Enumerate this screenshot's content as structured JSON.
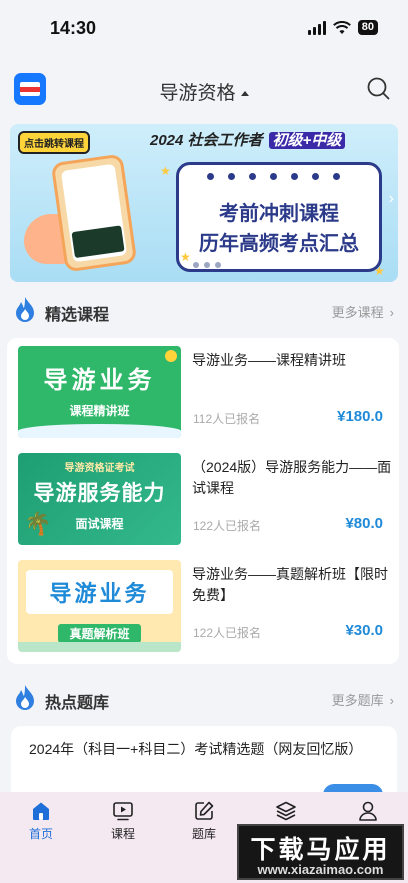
{
  "status_bar": {
    "time": "14:30",
    "battery": "80"
  },
  "header": {
    "title": "导游资格",
    "logo_icon": "book-logo-icon",
    "search_icon": "search-icon"
  },
  "banner": {
    "tag": "点击跳转课程",
    "headline": "2024 社会工作者",
    "highlight": "初级+中级",
    "line1": "考前冲刺课程",
    "line2": "历年高频考点汇总"
  },
  "featured": {
    "title": "精选课程",
    "more": "更多课程",
    "courses": [
      {
        "name": "导游业务——课程精讲班",
        "enrolled": "112人已报名",
        "price": "¥180.0",
        "thumb_title": "导游业务",
        "thumb_sub": "课程精讲班"
      },
      {
        "name": "（2024版）导游服务能力——面试课程",
        "enrolled": "122人已报名",
        "price": "¥80.0",
        "thumb_top": "导游资格证考试",
        "thumb_title": "导游服务能力",
        "thumb_sub": "面试课程"
      },
      {
        "name": "导游业务——真题解析班【限时免费】",
        "enrolled": "122人已报名",
        "price": "¥30.0",
        "thumb_title": "导游业务",
        "thumb_sub": "真题解析班"
      }
    ]
  },
  "hot_questions": {
    "title": "热点题库",
    "more": "更多题库",
    "items": [
      {
        "title": "2024年（科目一+科目二）考试精选题（网友回忆版）"
      }
    ]
  },
  "tabbar": {
    "tabs": [
      {
        "label": "首页",
        "icon": "home-icon"
      },
      {
        "label": "课程",
        "icon": "video-icon"
      },
      {
        "label": "题库",
        "icon": "edit-icon"
      },
      {
        "label": "资料",
        "icon": "layers-icon"
      },
      {
        "label": "我的",
        "icon": "user-icon"
      }
    ]
  },
  "watermark": {
    "main": "下载马应用",
    "sub": "www.xiazaimao.com"
  },
  "colors": {
    "accent": "#1f8ad8",
    "tab_active": "#1f6fd8",
    "thumb_green": "#2fb76a"
  }
}
